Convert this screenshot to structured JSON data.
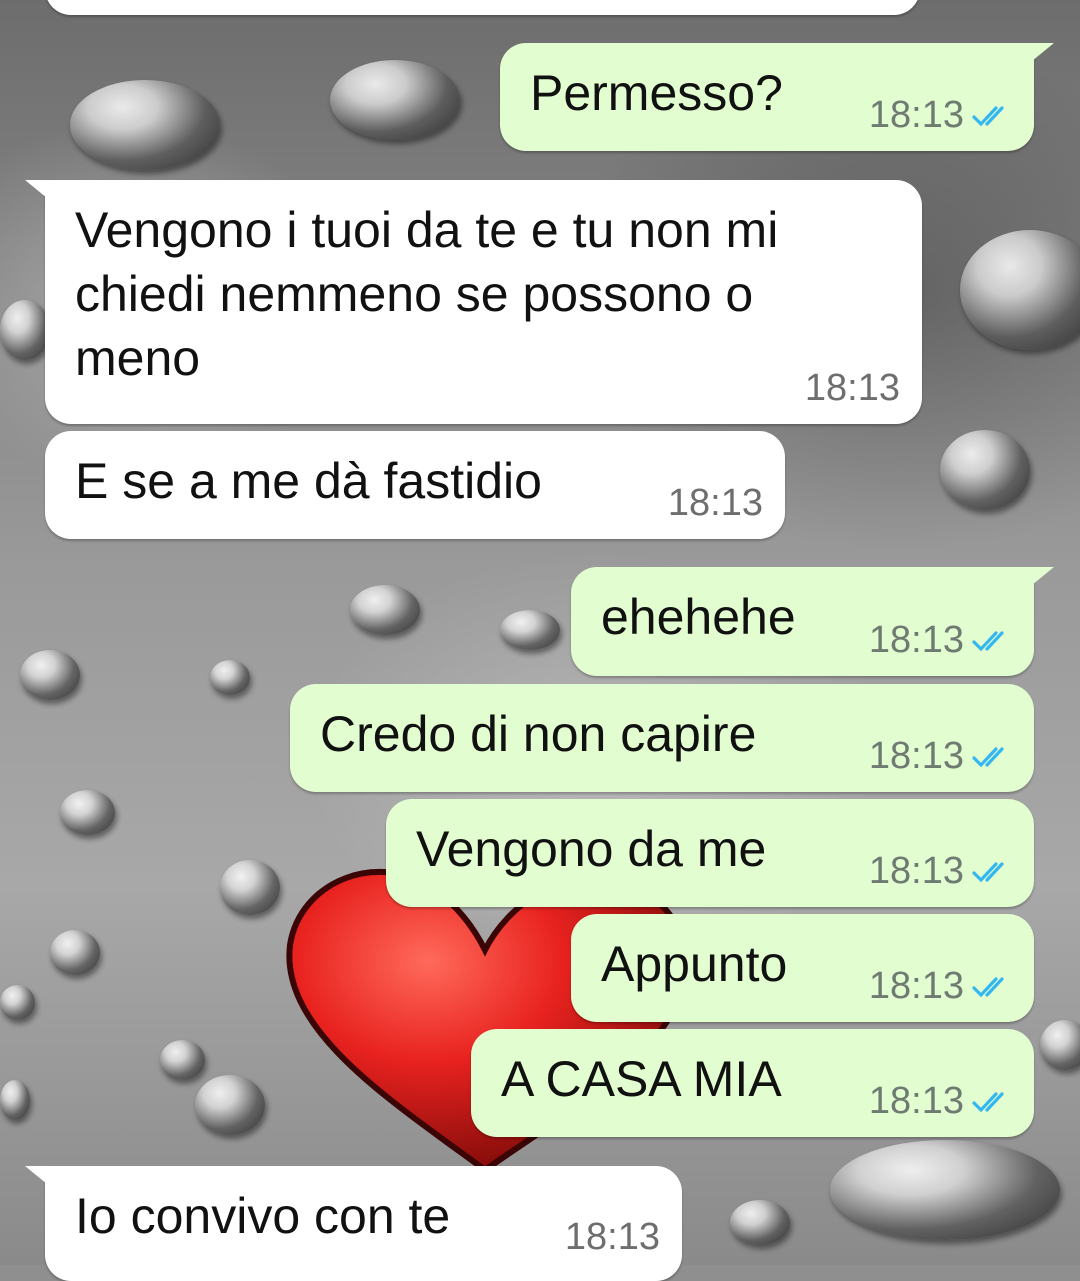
{
  "colors": {
    "incoming_bubble": "#ffffff",
    "outgoing_bubble": "#e2fdd0",
    "read_receipt": "#34b7f1",
    "heart": "#e8221f"
  },
  "wallpaper": {
    "subject": "water-drops-red-heart"
  },
  "messages": [
    {
      "direction": "out",
      "text": "Permesso?",
      "time": "18:13",
      "status": "read",
      "icon": "double-check-icon"
    },
    {
      "direction": "in",
      "lines": [
        "Vengono i tuoi da te e tu non mi",
        "chiedi nemmeno se possono o",
        "meno"
      ],
      "time": "18:13"
    },
    {
      "direction": "in",
      "text": "E se a me dà fastidio",
      "time": "18:13"
    },
    {
      "direction": "out",
      "text": "ehehehe",
      "time": "18:13",
      "status": "read",
      "icon": "double-check-icon"
    },
    {
      "direction": "out",
      "text": "Credo di non capire",
      "time": "18:13",
      "status": "read",
      "icon": "double-check-icon"
    },
    {
      "direction": "out",
      "text": "Vengono da me",
      "time": "18:13",
      "status": "read",
      "icon": "double-check-icon"
    },
    {
      "direction": "out",
      "text": "Appunto",
      "time": "18:13",
      "status": "read",
      "icon": "double-check-icon"
    },
    {
      "direction": "out",
      "text": "A CASA MIA",
      "time": "18:13",
      "status": "read",
      "icon": "double-check-icon"
    },
    {
      "direction": "in",
      "text": "Io convivo con te",
      "time": "18:13"
    }
  ]
}
